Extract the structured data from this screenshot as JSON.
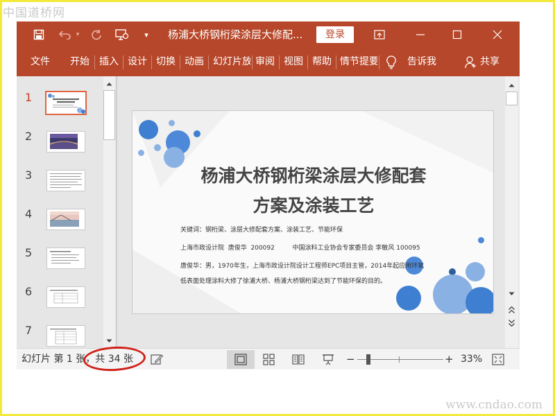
{
  "watermarks": {
    "top": "中国道桥网",
    "bottom": "www.cndao.com"
  },
  "titlebar": {
    "document_title": "杨浦大桥钢桁梁涂层大修配...",
    "login_label": "登录",
    "quick_access_icons": [
      "save-icon",
      "undo-icon",
      "redo-icon",
      "present-from-start-icon",
      "customize-qat-icon"
    ],
    "window_controls": [
      "ribbon-display-options-icon",
      "minimize-icon",
      "maximize-icon",
      "close-icon"
    ]
  },
  "ribbon": {
    "tabs": [
      "文件",
      "开始",
      "插入",
      "设计",
      "切换",
      "动画",
      "幻灯片放",
      "审阅",
      "视图",
      "帮助",
      "情节提要"
    ],
    "tell_me": "告诉我",
    "share": "共享"
  },
  "thumbnails": {
    "numbers": [
      "1",
      "2",
      "3",
      "4",
      "5",
      "6",
      "7"
    ],
    "active_index": 1
  },
  "slide": {
    "title_line1": "杨浦大桥钢桁梁涂层大修配套",
    "title_line2": "方案及涂装工艺",
    "keywords": "关键词：钢桁梁、涂层大修配套方案、涂装工艺、节能环保",
    "authors": "上海市政设计院  唐俊华  200092         中国涂料工业协会专家委员会 李敏风 100095",
    "bio_line1": "唐俊华：男，1970年生，上海市政设计院设计工程师EPC项目主管，2014年起应用环氧",
    "bio_line2": "低表面处理涂料大修了徐浦大桥、杨浦大桥钢桁梁达到了节能环保的目的。"
  },
  "statusbar": {
    "slide_label": "幻灯片 第 1 张，共 34 张",
    "zoom": "33%",
    "zoom_minus": "−",
    "zoom_plus": "+",
    "view_icons": [
      "normal-view-icon",
      "slide-sorter-icon",
      "reading-view-icon",
      "slideshow-icon"
    ]
  },
  "colors": {
    "accent": "#b7472a",
    "active_thumb": "#e0633e",
    "annotation": "#d0221a",
    "circle_blue": "#3f7fd1"
  }
}
